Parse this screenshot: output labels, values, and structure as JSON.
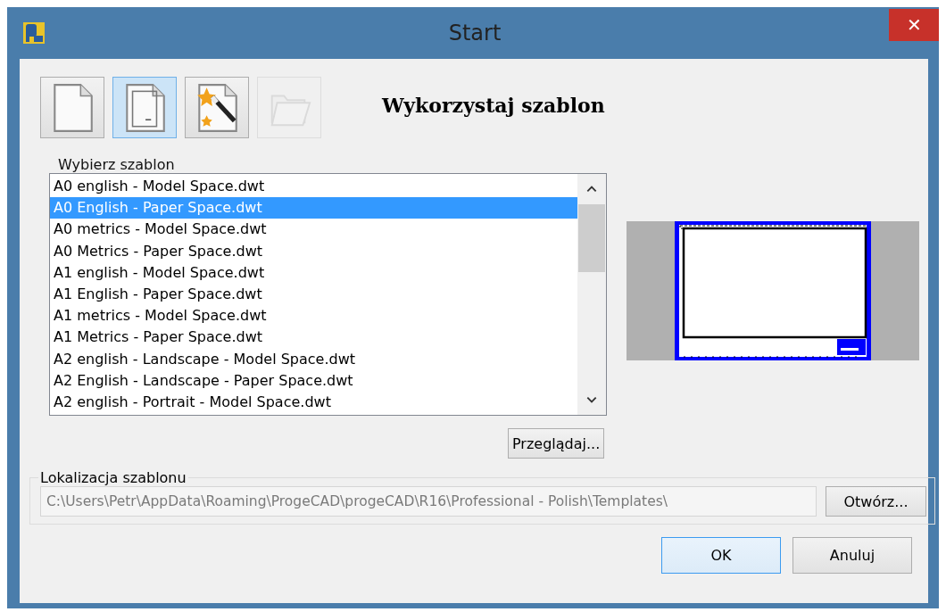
{
  "window": {
    "title": "Start",
    "close": "✕"
  },
  "toolbar": [
    {
      "kind": "blank",
      "selected": false,
      "disabled": false
    },
    {
      "kind": "template",
      "selected": true,
      "disabled": false
    },
    {
      "kind": "wizard",
      "selected": false,
      "disabled": false
    },
    {
      "kind": "open",
      "selected": false,
      "disabled": true
    }
  ],
  "heading": "Wykorzystaj szablon",
  "template_list": {
    "label": "Wybierz szablon",
    "items": [
      {
        "name": "A0 english - Model Space.dwt",
        "selected": false
      },
      {
        "name": "A0 English - Paper Space.dwt",
        "selected": true
      },
      {
        "name": "A0 metrics - Model Space.dwt",
        "selected": false
      },
      {
        "name": "A0 Metrics - Paper Space.dwt",
        "selected": false
      },
      {
        "name": "A1 english - Model Space.dwt",
        "selected": false
      },
      {
        "name": "A1 English - Paper Space.dwt",
        "selected": false
      },
      {
        "name": "A1 metrics - Model Space.dwt",
        "selected": false
      },
      {
        "name": "A1 Metrics - Paper Space.dwt",
        "selected": false
      },
      {
        "name": "A2 english - Landscape - Model Space.dwt",
        "selected": false
      },
      {
        "name": "A2 English - Landscape - Paper Space.dwt",
        "selected": false
      },
      {
        "name": "A2 english - Portrait - Model Space.dwt",
        "selected": false
      }
    ]
  },
  "browse_button": "Przeglądaj...",
  "location": {
    "label": "Lokalizacja szablonu",
    "path": "C:\\Users\\Petr\\AppData\\Roaming\\ProgeCAD\\progeCAD\\R16\\Professional - Polish\\Templates\\",
    "open_button": "Otwórz..."
  },
  "buttons": [
    {
      "label": "OK",
      "default": true
    },
    {
      "label": "Anuluj",
      "default": false
    }
  ]
}
